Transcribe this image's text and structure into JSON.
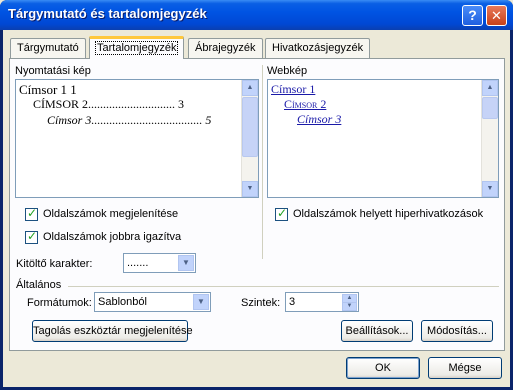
{
  "window": {
    "title": "Tárgymutató és tartalomjegyzék",
    "help_glyph": "?",
    "close_glyph": "✕"
  },
  "tabs": [
    {
      "label": "Tárgymutató"
    },
    {
      "label": "Tartalomjegyzék",
      "active": true
    },
    {
      "label": "Ábrajegyzék"
    },
    {
      "label": "Hivatkozásjegyzék"
    }
  ],
  "print_preview": {
    "label": "Nyomtatási kép",
    "lines": [
      {
        "text": "Címsor 1 1"
      },
      {
        "text": "CÍMSOR 2............................. 3"
      },
      {
        "text": "Címsor 3..................................... 5"
      }
    ]
  },
  "web_preview": {
    "label": "Webkép",
    "links": [
      "Címsor 1",
      "Címsor 2",
      "Címsor 3"
    ]
  },
  "options": {
    "show_page_numbers": "Oldalszámok megjelenítése",
    "right_align_page_numbers": "Oldalszámok jobbra igazítva",
    "hyperlinks_instead": "Oldalszámok helyett hiperhivatkozások",
    "tab_leader_label": "Kitöltő karakter:",
    "tab_leader_value": "......."
  },
  "general": {
    "label": "Általános",
    "formats_label": "Formátumok:",
    "formats_value": "Sablonból",
    "levels_label": "Szintek:",
    "levels_value": "3"
  },
  "buttons": {
    "outline_toolbar": "Tagolás eszköztár megjelenítése",
    "options": "Beállítások...",
    "modify": "Módosítás...",
    "ok": "OK",
    "cancel": "Mégse"
  },
  "colors": {
    "titlebar": "#0054e3",
    "tab_highlight": "#ffc83c",
    "link": "#1a1aa8"
  }
}
